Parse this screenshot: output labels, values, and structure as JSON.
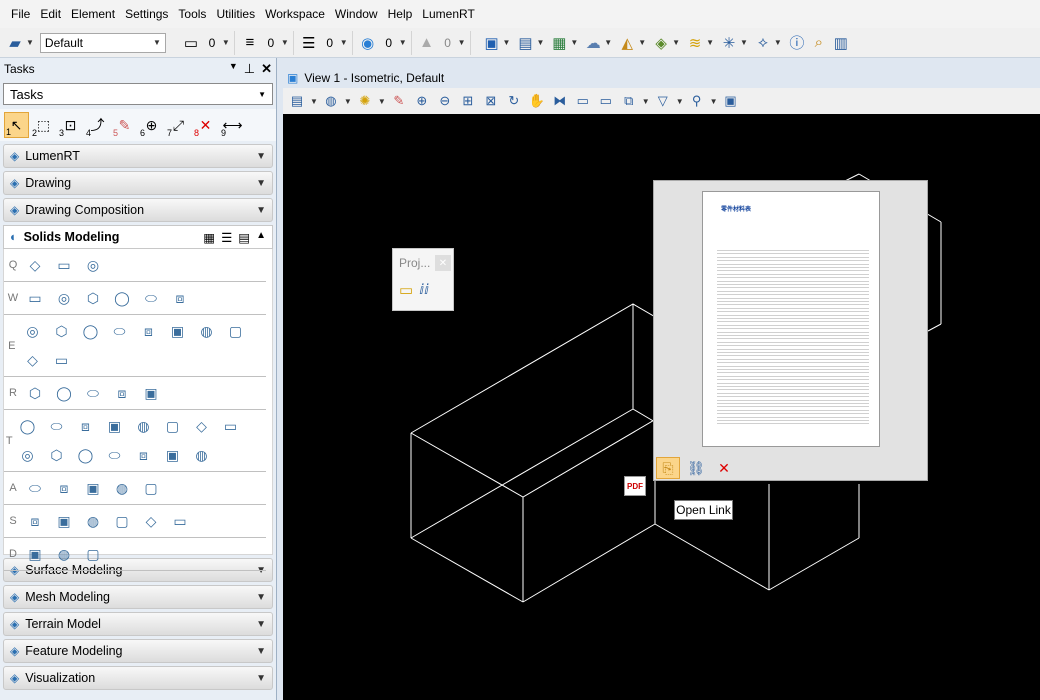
{
  "menu": [
    "File",
    "Edit",
    "Element",
    "Settings",
    "Tools",
    "Utilities",
    "Workspace",
    "Window",
    "Help",
    "LumenRT"
  ],
  "toolbar": {
    "level_combo": "Default",
    "color_value": "0",
    "style_value": "0",
    "weight_value": "0",
    "transparency_value": "0",
    "priority_value": "0"
  },
  "tasks": {
    "title": "Tasks",
    "combo_value": "Tasks",
    "sections_top": [
      "LumenRT",
      "Drawing",
      "Drawing Composition"
    ],
    "solids": {
      "title": "Solids Modeling",
      "rows": [
        {
          "key": "Q",
          "count": 3
        },
        {
          "key": "W",
          "count": 6
        },
        {
          "key": "E",
          "count": 10
        },
        {
          "key": "R",
          "count": 5
        },
        {
          "key": "T",
          "count": 15
        },
        {
          "key": "A",
          "count": 5
        },
        {
          "key": "S",
          "count": 6
        },
        {
          "key": "D",
          "count": 3
        }
      ]
    },
    "sections_bottom": [
      "Surface Modeling",
      "Mesh Modeling",
      "Terrain Model",
      "Feature Modeling",
      "Visualization"
    ]
  },
  "view": {
    "title": "View 1 - Isometric, Default"
  },
  "popup": {
    "title": "Proj..."
  },
  "preview": {
    "doc_title": "零件材料表"
  },
  "tooltip": "Open Link",
  "pdf_label": "PDF"
}
